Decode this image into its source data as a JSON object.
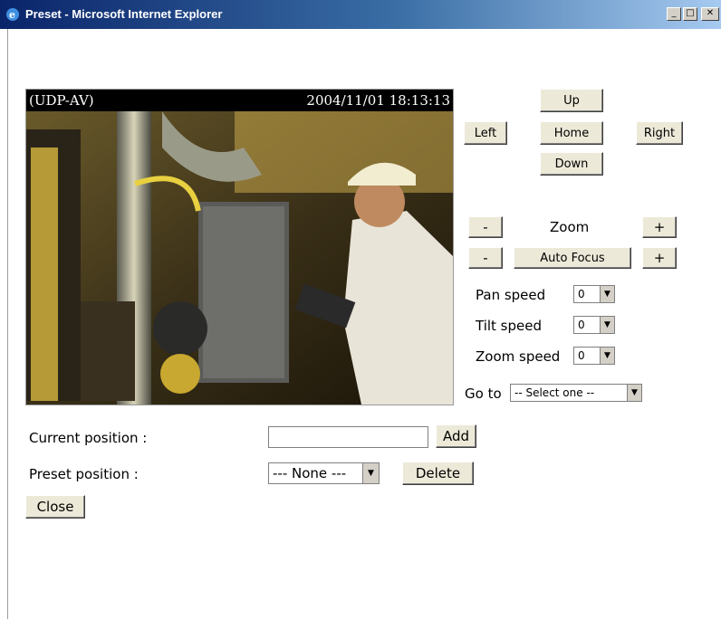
{
  "window": {
    "title": "Preset - Microsoft Internet Explorer",
    "minimize": "_",
    "maximize": "□",
    "close": "✕"
  },
  "video": {
    "channel": "(UDP-AV)",
    "timestamp": "2004/11/01 18:13:13"
  },
  "ptz": {
    "up": "Up",
    "left": "Left",
    "home": "Home",
    "right": "Right",
    "down": "Down",
    "zoom_minus": "-",
    "zoom_label": "Zoom",
    "zoom_plus": "+",
    "focus_minus": "-",
    "auto_focus": "Auto Focus",
    "focus_plus": "+"
  },
  "speeds": {
    "pan_label": "Pan speed",
    "pan_value": "0",
    "tilt_label": "Tilt speed",
    "tilt_value": "0",
    "zoom_label": "Zoom speed",
    "zoom_value": "0"
  },
  "goto": {
    "label": "Go to",
    "value": "-- Select one --"
  },
  "form": {
    "current_label": "Current position :",
    "current_value": "",
    "add": "Add",
    "preset_label": "Preset position :",
    "preset_value": "--- None ---",
    "delete": "Delete",
    "close": "Close"
  },
  "colors": {
    "titlebar": "#0a246a",
    "button_face": "#ece9d8"
  }
}
